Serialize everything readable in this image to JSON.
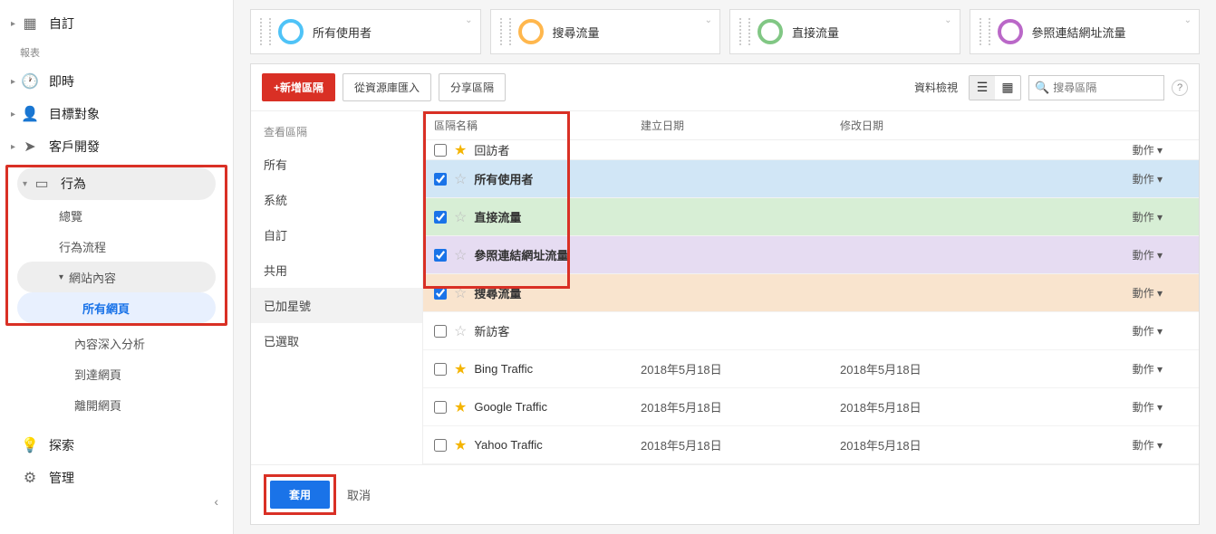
{
  "sidebar": {
    "custom": "自訂",
    "reports_label": "報表",
    "realtime": "即時",
    "audience": "目標對象",
    "acquisition": "客戶開發",
    "behavior": "行為",
    "behavior_sub": {
      "overview": "總覽",
      "flow": "行為流程",
      "site_content": "網站內容",
      "all_pages": "所有網頁",
      "drilldown": "內容深入分析",
      "landing": "到達網頁",
      "exit": "離開網頁"
    },
    "discover": "探索",
    "admin": "管理"
  },
  "segment_cards": [
    {
      "label": "所有使用者",
      "color": "#4fc3f7"
    },
    {
      "label": "搜尋流量",
      "color": "#ffb74d"
    },
    {
      "label": "直接流量",
      "color": "#81c784"
    },
    {
      "label": "參照連結網址流量",
      "color": "#ba68c8"
    }
  ],
  "toolbar": {
    "new_segment": "+新增區隔",
    "import": "從資源庫匯入",
    "share": "分享區隔",
    "view_label": "資料檢視",
    "search_placeholder": "搜尋區隔"
  },
  "filters": {
    "header": "查看區隔",
    "all": "所有",
    "system": "系統",
    "custom": "自訂",
    "shared": "共用",
    "starred": "已加星號",
    "selected": "已選取"
  },
  "columns": {
    "name": "區隔名稱",
    "created": "建立日期",
    "modified": "修改日期"
  },
  "actions_label": "動作",
  "rows": [
    {
      "checked": false,
      "starred": true,
      "name": "回訪者",
      "created": "",
      "modified": "",
      "hl": "",
      "partial": true
    },
    {
      "checked": true,
      "starred": false,
      "name": "所有使用者",
      "created": "",
      "modified": "",
      "hl": "hl-blue"
    },
    {
      "checked": true,
      "starred": false,
      "name": "直接流量",
      "created": "",
      "modified": "",
      "hl": "hl-green"
    },
    {
      "checked": true,
      "starred": false,
      "name": "參照連結網址流量",
      "created": "",
      "modified": "",
      "hl": "hl-purple"
    },
    {
      "checked": true,
      "starred": false,
      "name": "搜尋流量",
      "created": "",
      "modified": "",
      "hl": "hl-orange"
    },
    {
      "checked": false,
      "starred": false,
      "name": "新訪客",
      "created": "",
      "modified": "",
      "hl": ""
    },
    {
      "checked": false,
      "starred": true,
      "name": "Bing Traffic",
      "created": "2018年5月18日",
      "modified": "2018年5月18日",
      "hl": ""
    },
    {
      "checked": false,
      "starred": true,
      "name": "Google Traffic",
      "created": "2018年5月18日",
      "modified": "2018年5月18日",
      "hl": ""
    },
    {
      "checked": false,
      "starred": true,
      "name": "Yahoo Traffic",
      "created": "2018年5月18日",
      "modified": "2018年5月18日",
      "hl": ""
    }
  ],
  "footer": {
    "apply": "套用",
    "cancel": "取消"
  }
}
